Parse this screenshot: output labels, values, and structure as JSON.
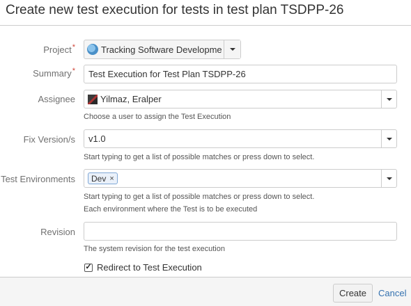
{
  "dialog": {
    "title": "Create new test execution for tests in test plan TSDPP-26"
  },
  "form": {
    "project": {
      "label": "Project",
      "value": "Tracking Software Developmen",
      "required_marker": "*",
      "icon": "project-avatar-icon"
    },
    "summary": {
      "label": "Summary",
      "value": "Test Execution for Test Plan TSDPP-26",
      "required_marker": "*"
    },
    "assignee": {
      "label": "Assignee",
      "value": "Yilmaz, Eralper",
      "description": "Choose a user to assign the Test Execution",
      "icon": "user-avatar-icon"
    },
    "fix_version": {
      "label": "Fix Version/s",
      "value": "v1.0",
      "description": "Start typing to get a list of possible matches or press down to select."
    },
    "test_environments": {
      "label": "Test Environments",
      "tags": [
        {
          "label": "Dev",
          "remove": "×"
        }
      ],
      "description_1": "Start typing to get a list of possible matches or press down to select.",
      "description_2": "Each environment where the Test is to be executed"
    },
    "revision": {
      "label": "Revision",
      "value": "",
      "description": "The system revision for the test execution"
    },
    "redirect": {
      "label": "Redirect to Test Execution",
      "checked": true,
      "check_glyph": "✓"
    }
  },
  "footer": {
    "create_label": "Create",
    "cancel_label": "Cancel"
  },
  "colors": {
    "required": "#d04437",
    "link": "#3572b0",
    "border": "#cccccc",
    "label": "#707070"
  }
}
